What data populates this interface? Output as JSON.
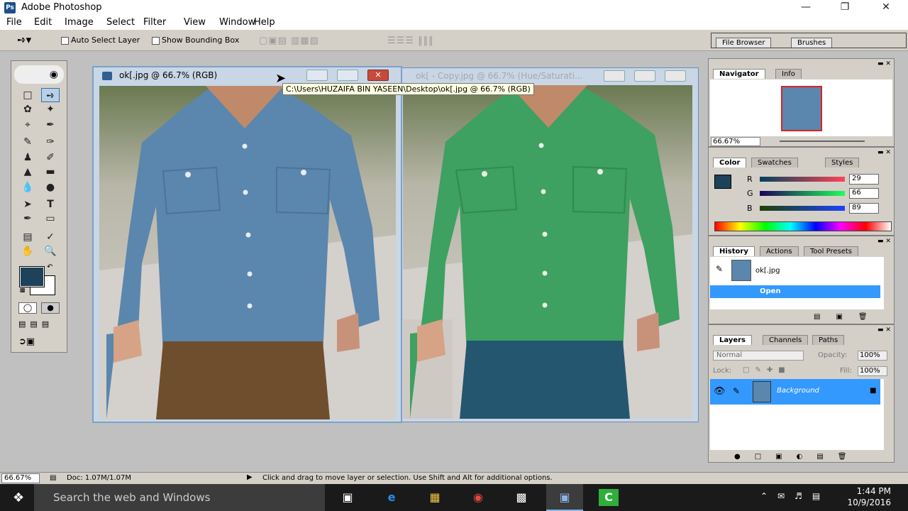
{
  "app": {
    "title": "Adobe Photoshop"
  },
  "menu": [
    "File",
    "Edit",
    "Image",
    "Select",
    "Filter",
    "View",
    "Window",
    "Help"
  ],
  "options": {
    "auto_select": "Auto Select Layer",
    "show_bounding": "Show Bounding Box"
  },
  "well": {
    "tabs": [
      "File Browser",
      "Brushes"
    ]
  },
  "doc1": {
    "title": "ok[.jpg @ 66.7% (RGB)"
  },
  "doc2": {
    "title": "ok[ - Copy.jpg @ 66.7% (Hue/Saturati..."
  },
  "tooltip": "C:\\Users\\HUZAIFA BIN YASEEN\\Desktop\\ok[.jpg @ 66.7% (RGB)",
  "navigator": {
    "tabs": [
      "Navigator",
      "Info"
    ],
    "zoom": "66.67%"
  },
  "color": {
    "tabs": [
      "Color",
      "Swatches",
      "Styles"
    ],
    "r_label": "R",
    "g_label": "G",
    "b_label": "B",
    "r": "29",
    "g": "66",
    "b": "89",
    "fg_hex": "#1d4259"
  },
  "history": {
    "tabs": [
      "History",
      "Actions",
      "Tool Presets"
    ],
    "snapshot": "ok[.jpg",
    "state": "Open"
  },
  "layers": {
    "tabs": [
      "Layers",
      "Channels",
      "Paths"
    ],
    "blend": "Normal",
    "opacity_label": "Opacity:",
    "opacity": "100%",
    "lock_label": "Lock:",
    "fill_label": "Fill:",
    "fill": "100%",
    "layer_name": "Background"
  },
  "status": {
    "zoom": "66.67%",
    "doc": "Doc: 1.07M/1.07M",
    "hint": "Click and drag to move layer or selection.  Use Shift and Alt for additional options."
  },
  "taskbar": {
    "search": "Search the web and Windows",
    "time": "1:44 PM",
    "date": "10/9/2016"
  }
}
